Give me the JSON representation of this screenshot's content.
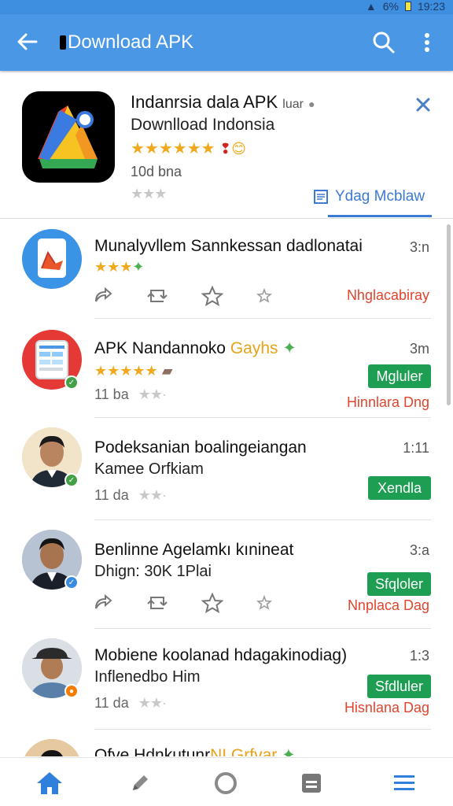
{
  "status": {
    "battery": "6%",
    "time": "19:23"
  },
  "appbar": {
    "title": "Download APK",
    "back_icon": "arrow-left-icon",
    "search_icon": "search-icon",
    "more_icon": "more-vertical-icon"
  },
  "hero": {
    "title": "Indanrsia dala APK",
    "title_tail": "luar",
    "subtitle": "Downlload Indonsia",
    "stars": "★★★★★★",
    "size": "10d bna",
    "rating": "★★★",
    "link": "Ydag Mcblaw"
  },
  "items": [
    {
      "name": "Munalyvllem Sannkessan dadlonatai",
      "time": "3:n",
      "stars": "★★★",
      "red": "Nhglacabiray"
    },
    {
      "name": "APK Nandannoko",
      "name_tail": "Gayhs",
      "time": "3m",
      "stars": "★★★★★",
      "meta": "11 ba",
      "meta_stars": "★★·",
      "green": "Mgluler",
      "red": "Hinnlara Dng"
    },
    {
      "name": "Podeksanian boalingeiangan",
      "line2": "Kamee Orfkiam",
      "time": "1:11",
      "meta": "11 da",
      "meta_stars": "★★·",
      "green": "Xendla"
    },
    {
      "name": "Benlinne Agelamkı kınineat",
      "line2": "Dhign: 30K 1Plai",
      "time": "3:a",
      "green": "Sfqloler",
      "red": "Nnplaca Dag"
    },
    {
      "name": "Mobiene koolanad hdagakinodiag)",
      "line2": "Inflenedbo Him",
      "time": "1:3",
      "meta": "11 da",
      "meta_stars": "★★·",
      "green": "Sfdluler",
      "red": "Hisnlana Dag"
    },
    {
      "name": "Ofve Hdnkutunr",
      "name_tail": "NI Grfvar"
    }
  ],
  "nav": [
    "home-icon",
    "edit-icon",
    "circle-icon",
    "tablet-icon",
    "list-icon"
  ],
  "colors": {
    "appbar": "#4a97e6",
    "accent_blue": "#3d7ad4",
    "green": "#1e9e52",
    "red": "#e0452d",
    "star": "#f0a81c"
  }
}
